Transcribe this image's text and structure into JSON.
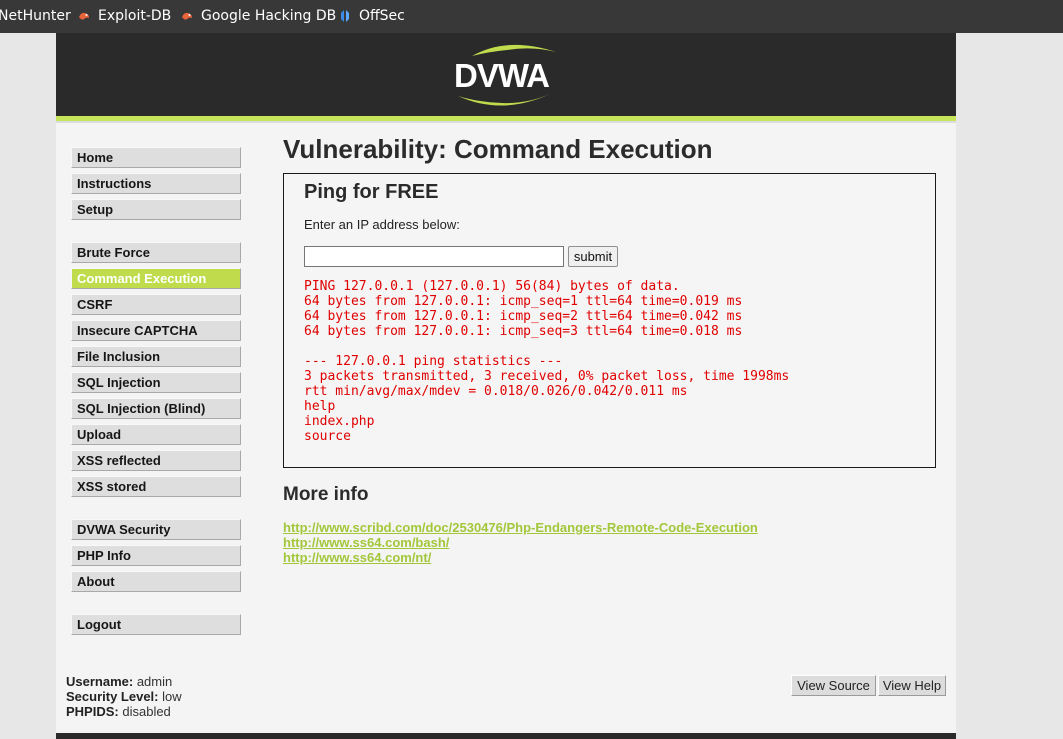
{
  "bookmarks": [
    {
      "label": "NetHunter",
      "icon": "nethunter-icon"
    },
    {
      "label": "Exploit-DB",
      "icon": "exploit-db-icon"
    },
    {
      "label": "Google Hacking DB",
      "icon": "ghdb-icon"
    },
    {
      "label": "OffSec",
      "icon": "offsec-icon"
    }
  ],
  "header": {
    "logo_text": "DVWA"
  },
  "menu": {
    "group1": [
      "Home",
      "Instructions",
      "Setup"
    ],
    "group2": [
      "Brute Force",
      "Command Execution",
      "CSRF",
      "Insecure CAPTCHA",
      "File Inclusion",
      "SQL Injection",
      "SQL Injection (Blind)",
      "Upload",
      "XSS reflected",
      "XSS stored"
    ],
    "group3": [
      "DVWA Security",
      "PHP Info",
      "About"
    ],
    "group4": [
      "Logout"
    ],
    "selected": "Command Execution"
  },
  "main": {
    "title": "Vulnerability: Command Execution",
    "box_title": "Ping for FREE",
    "prompt": "Enter an IP address below:",
    "input_value": "",
    "submit_label": "submit",
    "output_lines": [
      "PING 127.0.0.1 (127.0.0.1) 56(84) bytes of data.",
      "64 bytes from 127.0.0.1: icmp_seq=1 ttl=64 time=0.019 ms",
      "64 bytes from 127.0.0.1: icmp_seq=2 ttl=64 time=0.042 ms",
      "64 bytes from 127.0.0.1: icmp_seq=3 ttl=64 time=0.018 ms",
      "",
      "--- 127.0.0.1 ping statistics ---",
      "3 packets transmitted, 3 received, 0% packet loss, time 1998ms",
      "rtt min/avg/max/mdev = 0.018/0.026/0.042/0.011 ms",
      "help",
      "index.php",
      "source"
    ],
    "more_info_title": "More info",
    "links": [
      "http://www.scribd.com/doc/2530476/Php-Endangers-Remote-Code-Execution",
      "http://www.ss64.com/bash/",
      "http://www.ss64.com/nt/"
    ]
  },
  "footer": {
    "username_label": "Username:",
    "username": "admin",
    "security_label": "Security Level:",
    "security": "low",
    "phpids_label": "PHPIDS:",
    "phpids": "disabled",
    "view_source": "View Source",
    "view_help": "View Help"
  },
  "colors": {
    "accent": "#c0dc4d",
    "output": "#e00000",
    "link": "#a3c73a",
    "header_bg": "#2a2a2a"
  }
}
